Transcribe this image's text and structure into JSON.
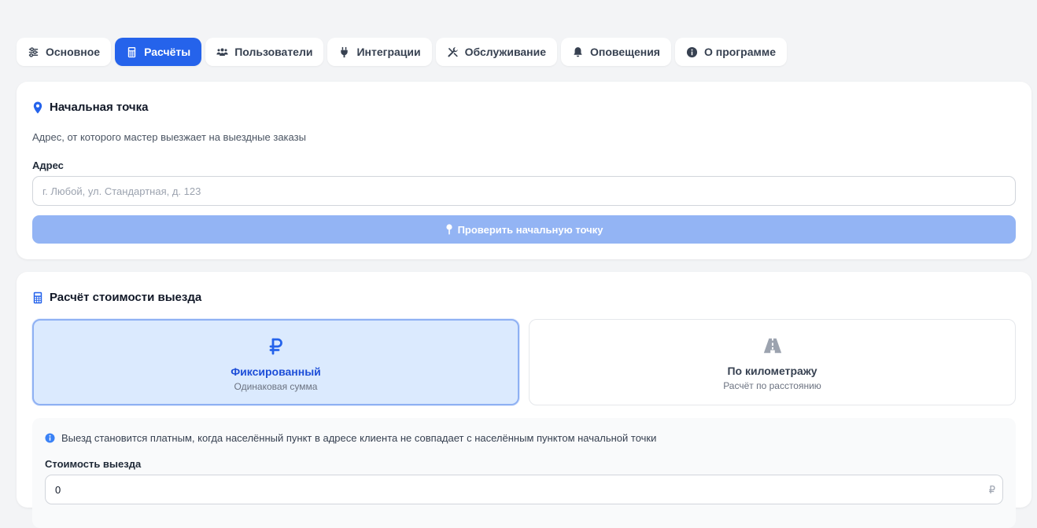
{
  "tabs": [
    {
      "label": "Основное",
      "icon": "sliders-icon",
      "active": false
    },
    {
      "label": "Расчёты",
      "icon": "calculator-icon",
      "active": true
    },
    {
      "label": "Пользователи",
      "icon": "users-icon",
      "active": false
    },
    {
      "label": "Интеграции",
      "icon": "plug-icon",
      "active": false
    },
    {
      "label": "Обслуживание",
      "icon": "tools-icon",
      "active": false
    },
    {
      "label": "Оповещения",
      "icon": "bell-icon",
      "active": false
    },
    {
      "label": "О программе",
      "icon": "info-icon",
      "active": false
    }
  ],
  "start_point": {
    "title": "Начальная точка",
    "description": "Адрес, от которого мастер выезжает на выездные заказы",
    "address_label": "Адрес",
    "address_value": "",
    "address_placeholder": "г. Любой, ул. Стандартная, д. 123",
    "check_button": "Проверить начальную точку"
  },
  "trip_cost": {
    "title": "Расчёт стоимости выезда",
    "options": [
      {
        "title": "Фиксированный",
        "subtitle": "Одинаковая сумма",
        "icon": "ruble-icon",
        "selected": true
      },
      {
        "title": "По километражу",
        "subtitle": "Расчёт по расстоянию",
        "icon": "road-icon",
        "selected": false
      }
    ],
    "info_text": "Выезд становится платным, когда населённый пункт в адресе клиента не совпадает с населённым пунктом начальной точки",
    "cost_label": "Стоимость выезда",
    "cost_value": "0",
    "cost_unit": "₽"
  },
  "colors": {
    "accent": "#2563eb",
    "accent_light": "#dbeafe",
    "button_disabled": "#93b4f4",
    "background": "#f3f4f6"
  }
}
